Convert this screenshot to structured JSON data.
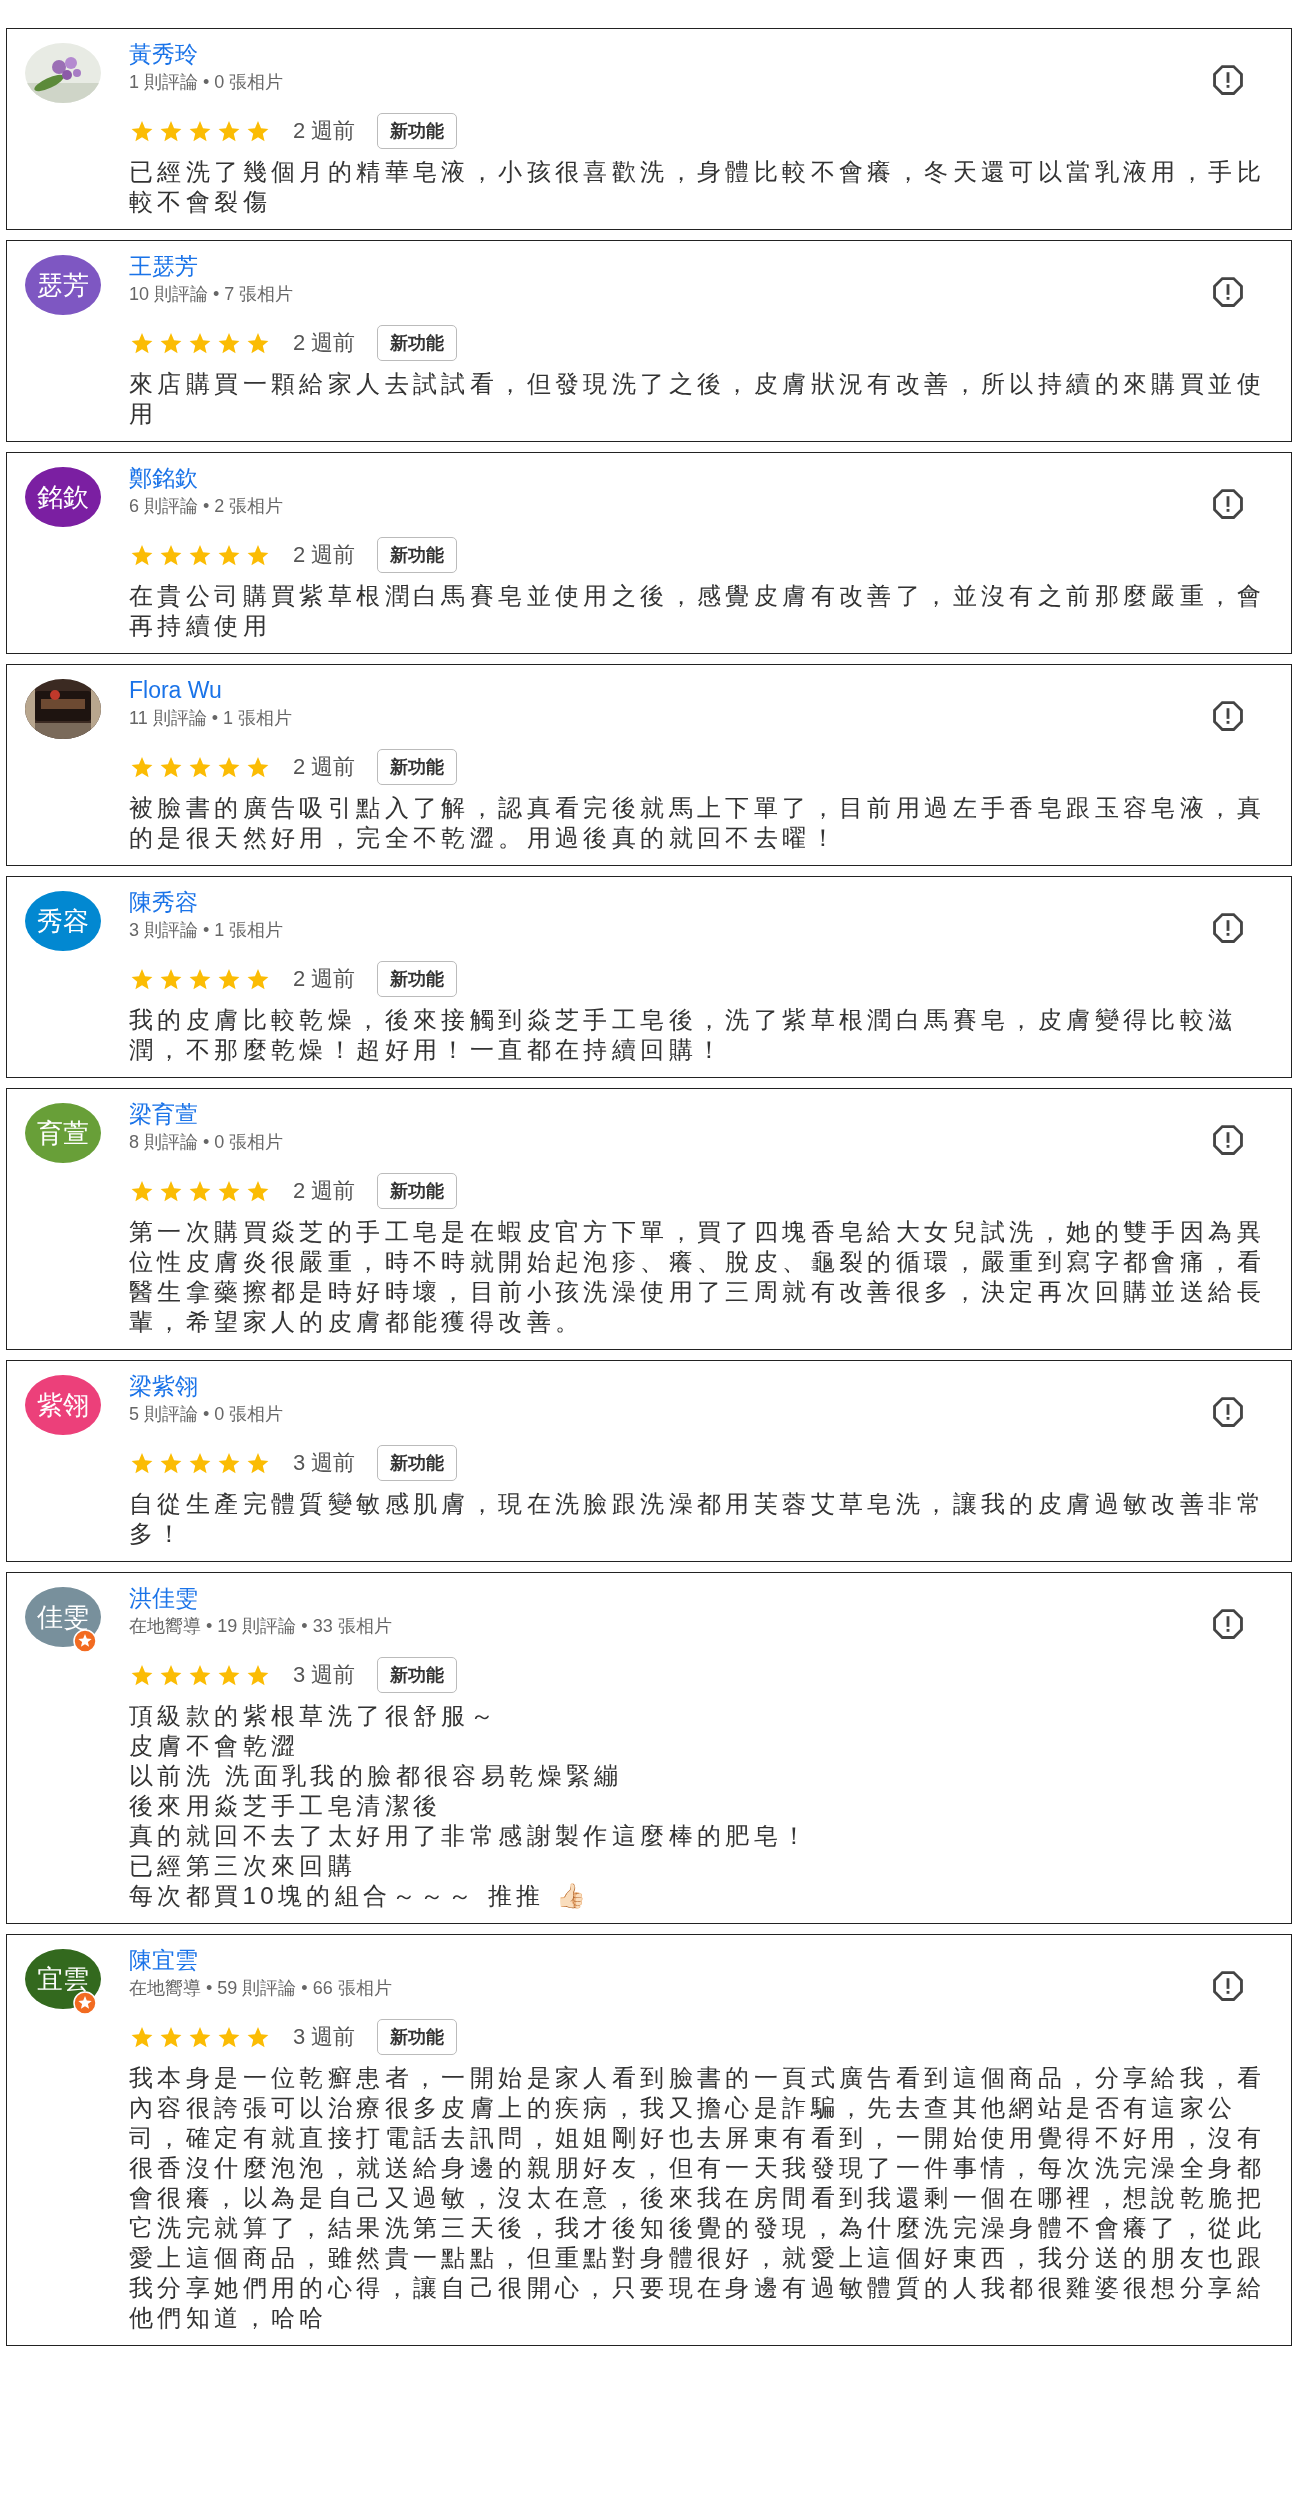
{
  "reviews": [
    {
      "name": "黃秀玲",
      "local_guide": false,
      "meta": "1 則評論 • 0 張相片",
      "stars": 5,
      "time": "2 週前",
      "tag": "新功能",
      "text": "已經洗了幾個月的精華皂液，小孩很喜歡洗，身體比較不會癢，冬天還可以當乳液用，手比較不會裂傷"
    },
    {
      "name": "王瑟芳",
      "avatar": {
        "kind": "initials",
        "text": "瑟芳",
        "color": "#7e57c2"
      },
      "local_guide": false,
      "meta": "10 則評論 • 7 張相片",
      "stars": 5,
      "time": "2 週前",
      "tag": "新功能",
      "text": "來店購買一顆給家人去試試看，但發現洗了之後，皮膚狀況有改善，所以持續的來購買並使用"
    },
    {
      "name": "鄭銘欽",
      "avatar": {
        "kind": "initials",
        "text": "銘欽",
        "color": "#7b1fa2"
      },
      "local_guide": false,
      "meta": "6 則評論 • 2 張相片",
      "stars": 5,
      "time": "2 週前",
      "tag": "新功能",
      "text": "在貴公司購買紫草根潤白馬賽皂並使用之後，感覺皮膚有改善了，並沒有之前那麼嚴重，會再持續使用"
    },
    {
      "name": "Flora Wu",
      "local_guide": false,
      "meta": "11 則評論 • 1 張相片",
      "stars": 5,
      "time": "2 週前",
      "tag": "新功能",
      "text": "被臉書的廣告吸引點入了解，認真看完後就馬上下單了，目前用過左手香皂跟玉容皂液，真的是很天然好用，完全不乾澀。用過後真的就回不去曜！"
    },
    {
      "name": "陳秀容",
      "avatar": {
        "kind": "initials",
        "text": "秀容",
        "color": "#0288d1"
      },
      "local_guide": false,
      "meta": "3 則評論 • 1 張相片",
      "stars": 5,
      "time": "2 週前",
      "tag": "新功能",
      "text": "我的皮膚比較乾燥，後來接觸到焱芝手工皂後，洗了紫草根潤白馬賽皂，皮膚變得比較滋潤，不那麼乾燥！超好用！一直都在持續回購！"
    },
    {
      "name": "梁育萱",
      "avatar": {
        "kind": "initials",
        "text": "育萱",
        "color": "#689f38"
      },
      "local_guide": false,
      "meta": "8 則評論 • 0 張相片",
      "stars": 5,
      "time": "2 週前",
      "tag": "新功能",
      "text": "第一次購買焱芝的手工皂是在蝦皮官方下單，買了四塊香皂給大女兒試洗，她的雙手因為異位性皮膚炎很嚴重，時不時就開始起泡疹、癢、脫皮、龜裂的循環，嚴重到寫字都會痛，看醫生拿藥擦都是時好時壞，目前小孩洗澡使用了三周就有改善很多，決定再次回購並送給長輩，希望家人的皮膚都能獲得改善。"
    },
    {
      "name": "梁紫翎",
      "avatar": {
        "kind": "initials",
        "text": "紫翎",
        "color": "#ec407a"
      },
      "local_guide": false,
      "meta": "5 則評論 • 0 張相片",
      "stars": 5,
      "time": "3 週前",
      "tag": "新功能",
      "text": "自從生產完體質變敏感肌膚，現在洗臉跟洗澡都用芙蓉艾草皂洗，讓我的皮膚過敏改善非常多！"
    },
    {
      "name": "洪佳雯",
      "avatar": {
        "kind": "initials",
        "text": "佳雯",
        "color": "#78909c"
      },
      "local_guide": true,
      "meta": "在地嚮導 • 19 則評論 • 33 張相片",
      "stars": 5,
      "time": "3 週前",
      "tag": "新功能",
      "text": [
        "頂級款的紫根草洗了很舒服～",
        "皮膚不會乾澀",
        "以前洗 洗面乳我的臉都很容易乾燥緊繃",
        "後來用焱芝手工皂清潔後",
        "真的就回不去了太好用了非常感謝製作這麼棒的肥皂！",
        "已經第三次來回購",
        "每次都買10塊的組合～～～ 推推 👍🏻"
      ]
    },
    {
      "name": "陳宜雲",
      "avatar": {
        "kind": "initials",
        "text": "宜雲",
        "color": "#33691e"
      },
      "local_guide": true,
      "meta": "在地嚮導 • 59 則評論 • 66 張相片",
      "stars": 5,
      "time": "3 週前",
      "tag": "新功能",
      "text": "我本身是一位乾癬患者，一開始是家人看到臉書的一頁式廣告看到這個商品，分享給我，看內容很誇張可以治療很多皮膚上的疾病，我又擔心是詐騙，先去查其他網站是否有這家公司，確定有就直接打電話去訊問，姐姐剛好也去屏東有看到，一開始使用覺得不好用，沒有很香沒什麼泡泡，就送給身邊的親朋好友，但有一天我發現了一件事情，每次洗完澡全身都會很癢，以為是自己又過敏，沒太在意，後來我在房間看到我還剩一個在哪裡，想說乾脆把它洗完就算了，結果洗第三天後，我才後知後覺的發現，為什麼洗完澡身體不會癢了，從此愛上這個商品，雖然貴一點點，但重點對身體很好，就愛上這個好東西，我分送的朋友也跟我分享她們用的心得，讓自己很開心，只要現在身邊有過敏體質的人我都很雞婆很想分享給他們知道，哈哈"
    }
  ]
}
